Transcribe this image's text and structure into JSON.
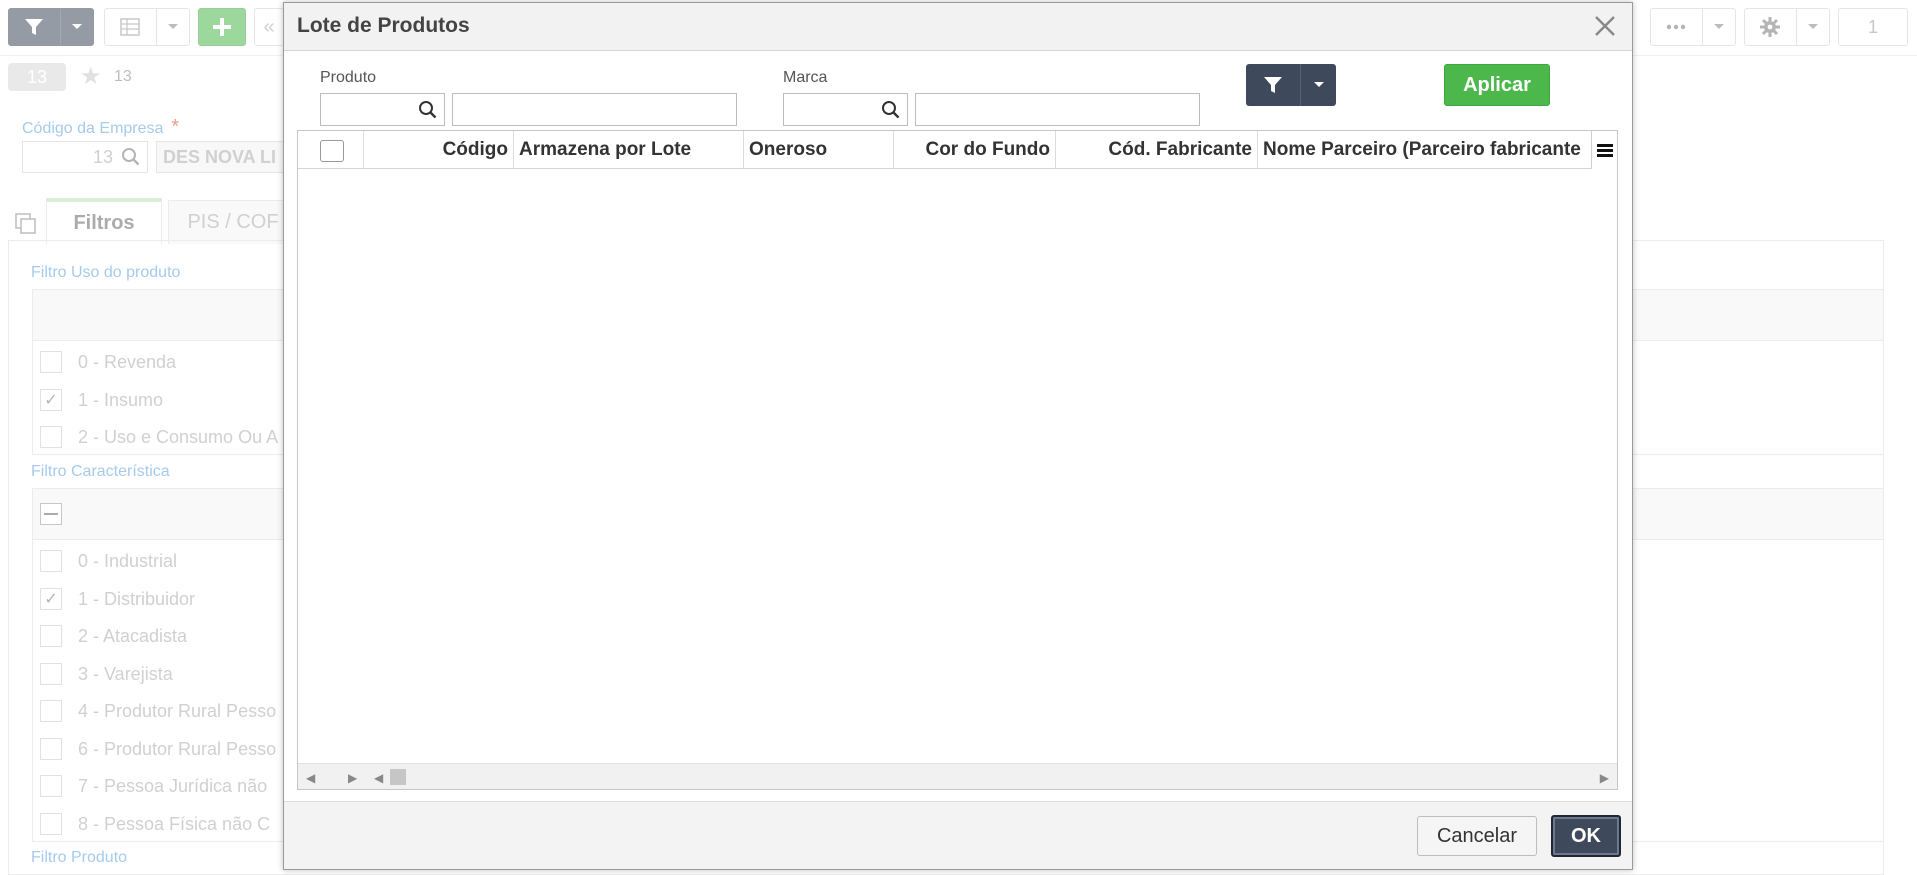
{
  "app": {
    "toolbar": {
      "page_indicator": "1"
    },
    "subbar": {
      "record_badge": "13",
      "favorites_count": "13"
    },
    "empresa": {
      "label": "Código da Empresa",
      "required_mark": "*",
      "code": "13",
      "name": "DES NOVA LI"
    },
    "tabs": [
      {
        "label": "Filtros",
        "active": true
      },
      {
        "label": "PIS / COF",
        "active": false
      }
    ],
    "filtro_uso": {
      "title": "Filtro Uso do produto",
      "items": [
        {
          "label": "0 - Revenda",
          "checked": false
        },
        {
          "label": "1 - Insumo",
          "checked": true
        },
        {
          "label": "2 - Uso e Consumo Ou A",
          "checked": false
        }
      ]
    },
    "filtro_caracteristica": {
      "title": "Filtro Característica",
      "items": [
        {
          "label": "0 - Industrial",
          "checked": false
        },
        {
          "label": "1 - Distribuidor",
          "checked": true
        },
        {
          "label": "2 - Atacadista",
          "checked": false
        },
        {
          "label": "3 - Varejista",
          "checked": false
        },
        {
          "label": "4 - Produtor Rural Pesso",
          "checked": false
        },
        {
          "label": "6 - Produtor Rural Pesso",
          "checked": false
        },
        {
          "label": "7 - Pessoa Jurídica não",
          "checked": false
        },
        {
          "label": "8 - Pessoa Física não C",
          "checked": false
        }
      ]
    },
    "filtro_produto": {
      "title": "Filtro Produto"
    }
  },
  "modal": {
    "title": "Lote de Produtos",
    "fields": {
      "produto_label": "Produto",
      "produto_code": "",
      "produto_desc": "",
      "marca_label": "Marca",
      "marca_code": "",
      "marca_desc": ""
    },
    "apply_label": "Aplicar",
    "grid": {
      "columns": [
        "Código",
        "Armazena por Lote",
        "Oneroso",
        "Cor do Fundo",
        "Cód. Fabricante",
        "Nome Parceiro (Parceiro fabricante"
      ],
      "rows": []
    },
    "cancel_label": "Cancelar",
    "ok_label": "OK"
  },
  "colors": {
    "primary_dark": "#3e4a5c",
    "accent_green": "#4cb84c",
    "link_blue": "#5a9fdc",
    "required_red": "#e04c2c"
  },
  "icons": {
    "close": "close-icon",
    "search": "search-icon",
    "filter": "filter-icon",
    "dropdown": "chevron-down-icon",
    "columns_menu": "hamburger-menu-icon",
    "gear": "gear-icon",
    "more": "more-dots-icon",
    "add": "plus-icon",
    "star": "star-icon",
    "copy": "copy-icon"
  }
}
